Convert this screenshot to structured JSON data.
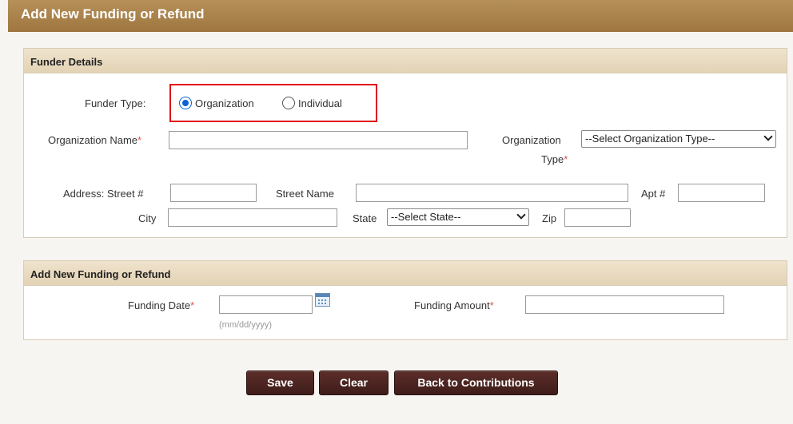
{
  "page": {
    "title": "Add New Funding or Refund"
  },
  "funder_details": {
    "header": "Funder Details",
    "funder_type_label": "Funder Type:",
    "funder_type_options": [
      {
        "label": "Organization",
        "selected": true
      },
      {
        "label": "Individual",
        "selected": false
      }
    ],
    "org_name_label": "Organization Name",
    "org_name_value": "",
    "org_type_label_line1": "Organization",
    "org_type_label_line2": "Type",
    "org_type_selected": "--Select Organization Type--",
    "street_num_label": "Address: Street #",
    "street_num_value": "",
    "street_name_label": "Street Name",
    "street_name_value": "",
    "apt_label": "Apt #",
    "apt_value": "",
    "city_label": "City",
    "city_value": "",
    "state_label": "State",
    "state_selected": "--Select State--",
    "zip_label": "Zip",
    "zip_value": ""
  },
  "funding": {
    "header": "Add New Funding or Refund",
    "date_label": "Funding Date",
    "date_value": "",
    "date_hint": "(mm/dd/yyyy)",
    "amount_label": "Funding Amount",
    "amount_value": ""
  },
  "buttons": {
    "save": "Save",
    "clear": "Clear",
    "back": "Back to Contributions"
  },
  "colors": {
    "title_bar": "#a88049",
    "panel_header": "#e8dac0",
    "button": "#4a2420",
    "required": "#d9534f",
    "highlight": "#e01010",
    "radio_selected": "#0a62d6"
  }
}
